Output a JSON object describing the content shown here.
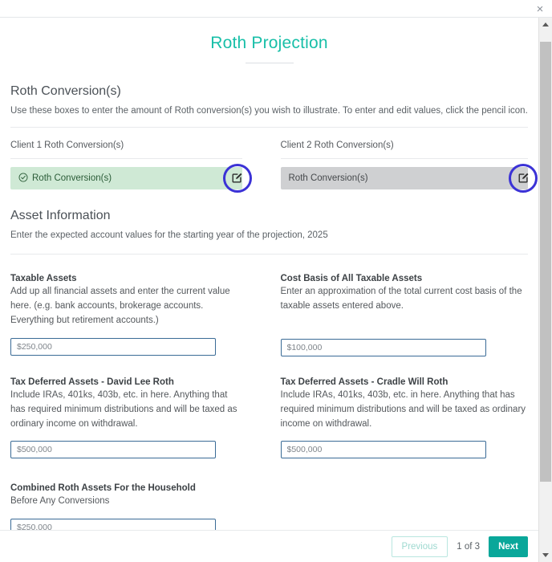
{
  "window": {
    "close_label": "×"
  },
  "modal": {
    "title": "Roth Projection"
  },
  "sections": {
    "conversions": {
      "heading": "Roth Conversion(s)",
      "description": "Use these boxes to enter the amount of Roth conversion(s) you wish to illustrate. To enter and edit values, click the pencil icon.",
      "client1": {
        "label": "Client 1 Roth Conversion(s)",
        "box_text": "Roth Conversion(s)",
        "state": "completed",
        "edit_label": "edit"
      },
      "client2": {
        "label": "Client 2 Roth Conversion(s)",
        "box_text": "Roth Conversion(s)",
        "state": "empty",
        "edit_label": "edit"
      }
    },
    "assets": {
      "heading": "Asset Information",
      "description": "Enter the expected account values for the starting year of the projection, 2025",
      "fields": [
        {
          "label": "Taxable Assets",
          "description": "Add up all financial assets and enter the current value here. (e.g. bank accounts, brokerage accounts. Everything but retirement accounts.)",
          "value": "$250,000"
        },
        {
          "label": "Cost Basis of All Taxable Assets",
          "description": "Enter an approximation of the total current cost basis of the taxable assets entered above.",
          "value": "$100,000"
        },
        {
          "label": "Tax Deferred Assets - David Lee Roth",
          "description": "Include IRAs, 401ks, 403b, etc. in here. Anything that has required minimum distributions and will be taxed as ordinary income on withdrawal.",
          "value": "$500,000"
        },
        {
          "label": "Tax Deferred Assets - Cradle Will Roth",
          "description": "Include IRAs, 401ks, 403b, etc. in here. Anything that has required minimum distributions and will be taxed as ordinary income on withdrawal.",
          "value": "$500,000"
        },
        {
          "label": "Combined Roth Assets For the Household",
          "description": "Before Any Conversions",
          "value": "$250,000"
        }
      ]
    }
  },
  "footer": {
    "previous_label": "Previous",
    "page_indicator": "1 of 3",
    "next_label": "Next"
  },
  "colors": {
    "accent_teal": "#0aa79a",
    "title_teal": "#18bfa8",
    "highlight_ring": "#3b32d6",
    "success_bg": "#cfe9d5",
    "neutral_bg": "#cfd0d2",
    "input_border": "#3a6b96"
  }
}
